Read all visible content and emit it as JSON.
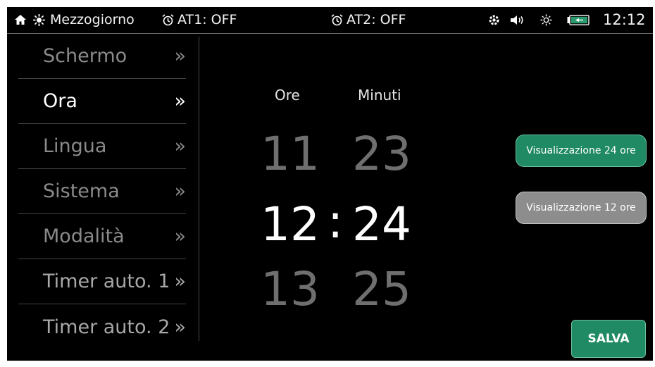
{
  "status_bar": {
    "mode_label": "Mezzogiorno",
    "timer1": "AT1: OFF",
    "timer2": "AT2: OFF",
    "clock": "12:12",
    "icons": [
      "home-icon",
      "sun-mode-icon",
      "alarm-clock-icon",
      "alarm-clock-icon",
      "gear-icon",
      "speaker-icon",
      "brightness-icon",
      "battery-icon"
    ]
  },
  "sidebar": {
    "chevron": "»",
    "items": [
      {
        "label": "Schermo"
      },
      {
        "label": "Ora"
      },
      {
        "label": "Lingua"
      },
      {
        "label": "Sistema"
      },
      {
        "label": "Modalità"
      },
      {
        "label": "Timer auto. 1"
      },
      {
        "label": "Timer auto. 2"
      }
    ],
    "active_index": 1
  },
  "time_picker": {
    "hours_label": "Ore",
    "minutes_label": "Minuti",
    "hours": {
      "prev": "11",
      "current": "12",
      "next": "13"
    },
    "minutes": {
      "prev": "23",
      "current": "24",
      "next": "25"
    },
    "separator": ":"
  },
  "buttons": {
    "format24": "Visualizzazione 24 ore",
    "format12": "Visualizzazione 12 ore",
    "save": "SALVA"
  },
  "colors": {
    "accent_green": "#1f8a64",
    "inactive_grey": "#8d8d8d"
  }
}
